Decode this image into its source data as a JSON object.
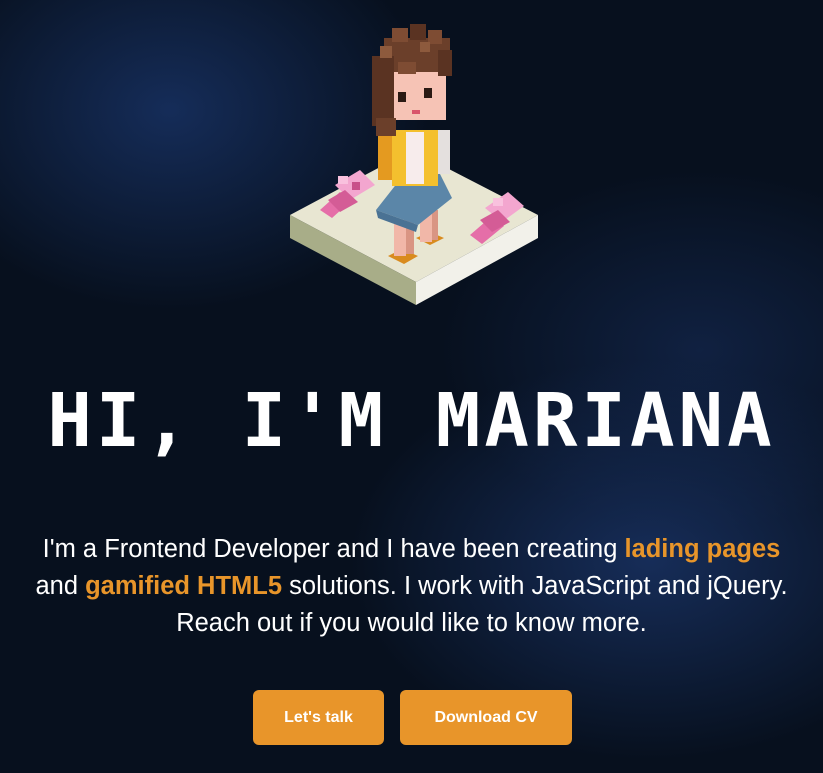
{
  "hero": {
    "title": "HI, I'M MARIANA",
    "intro_part1": "I'm a Frontend Developer and I have been creating ",
    "intro_highlight1": "lading pages",
    "intro_part2": " and ",
    "intro_highlight2": "gamified HTML5",
    "intro_part3": " solutions. I work with JavaScript and jQuery. Reach out if you would like to know more.",
    "illustration_icon": "voxel-girl-avatar-icon"
  },
  "actions": {
    "talk_label": "Let's talk",
    "cv_label": "Download CV"
  },
  "colors": {
    "accent": "#e8952a",
    "background": "#07101e",
    "text": "#ffffff"
  }
}
